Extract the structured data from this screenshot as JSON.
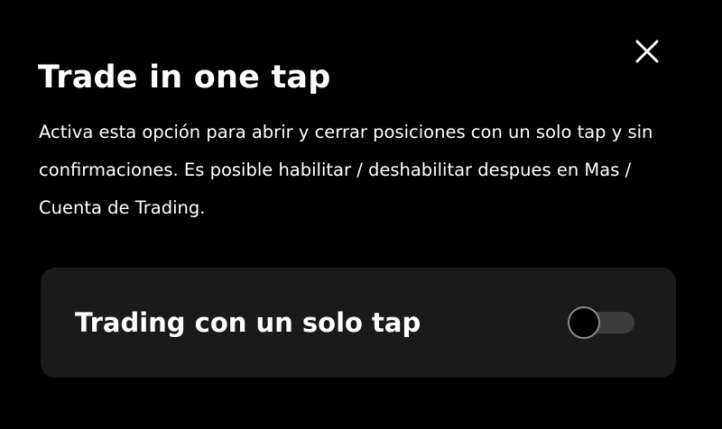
{
  "dialog": {
    "title": "Trade in one tap",
    "description": "Activa esta opción para abrir y cerrar posiciones con un solo tap y sin confirmaciones. Es posible habilitar / deshabilitar despues en Mas / Cuenta de Trading.",
    "close_icon": "close-icon"
  },
  "setting": {
    "label": "Trading con un solo tap",
    "toggle_on": false
  },
  "colors": {
    "background": "#000000",
    "card": "#1a1a1a",
    "text": "#ffffff",
    "toggle_track": "#3c3c3c"
  }
}
